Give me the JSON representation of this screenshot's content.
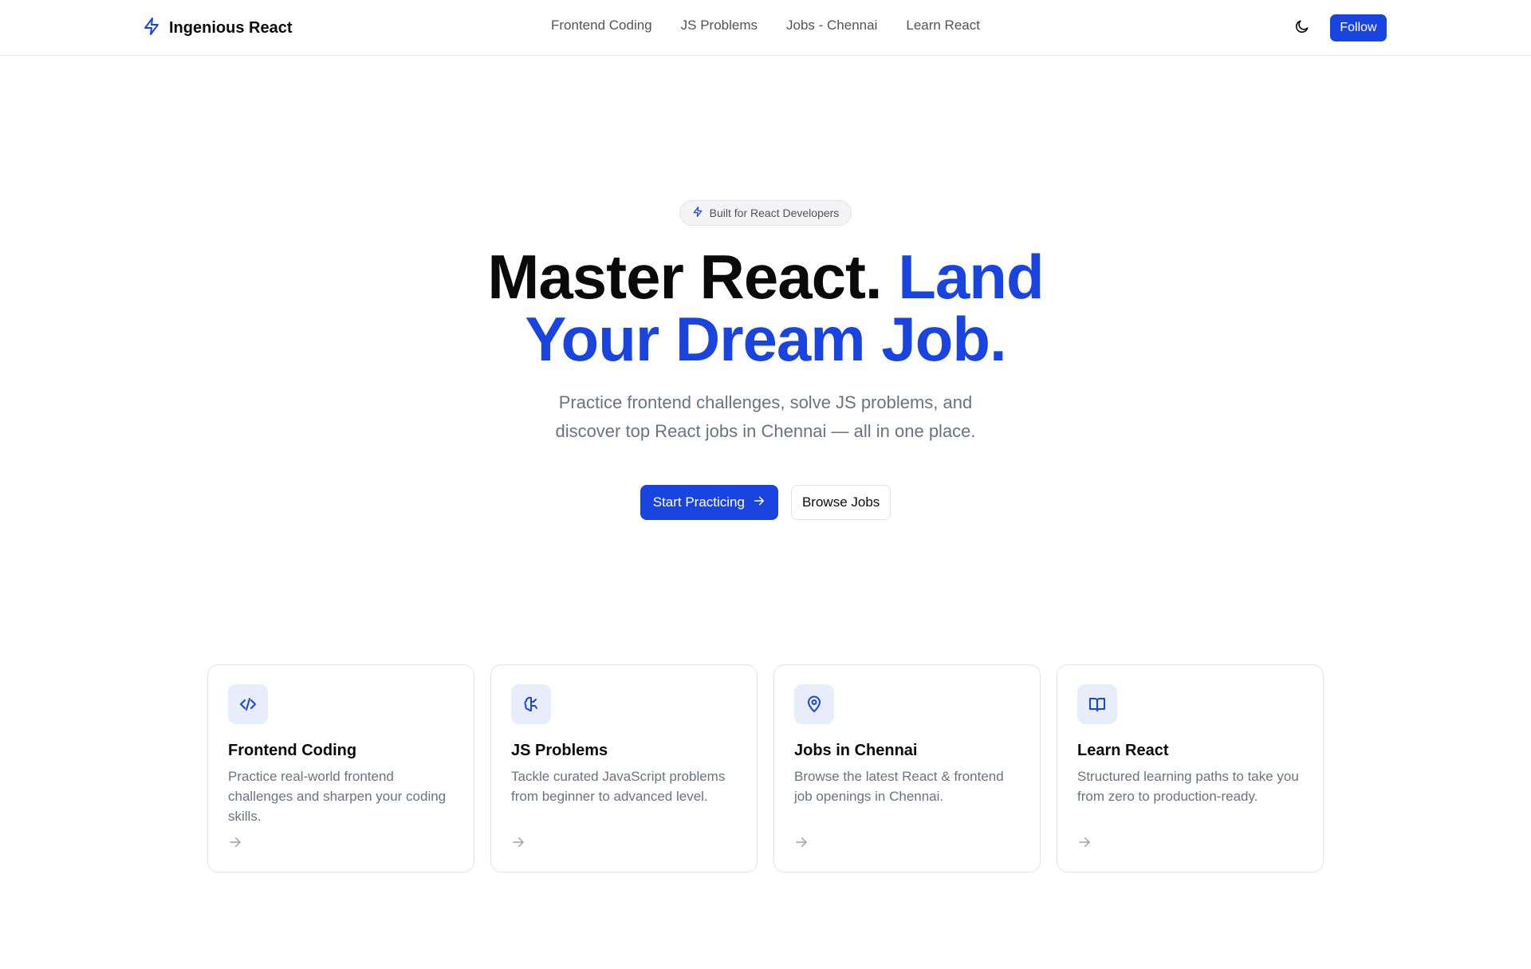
{
  "brand": {
    "name": "Ingenious React",
    "icon": "lightning-icon",
    "accent": "#1a44e0"
  },
  "nav": {
    "links": [
      "Frontend Coding",
      "JS Problems",
      "Jobs - Chennai",
      "Learn React"
    ],
    "theme_icon": "moon-icon",
    "follow_label": "Follow"
  },
  "hero": {
    "badge": "Built for React Developers",
    "title_part1": "Master React.",
    "title_part2": "Land",
    "title_part3": "Your Dream Job.",
    "subtitle_line1": "Practice frontend challenges, solve JS problems, and",
    "subtitle_line2": "discover top React jobs in Chennai — all in one place.",
    "primary_cta": "Start Practicing",
    "secondary_cta": "Browse Jobs"
  },
  "cards": [
    {
      "icon": "code-icon",
      "title": "Frontend Coding",
      "description": "Practice real-world frontend challenges and sharpen your coding skills."
    },
    {
      "icon": "brain-icon",
      "title": "JS Problems",
      "description": "Tackle curated JavaScript problems from beginner to advanced level."
    },
    {
      "icon": "map-pin-icon",
      "title": "Jobs in Chennai",
      "description": "Browse the latest React & frontend job openings in Chennai."
    },
    {
      "icon": "book-icon",
      "title": "Learn React",
      "description": "Structured learning paths to take you from zero to production-ready."
    }
  ],
  "colors": {
    "primary": "#1a44e0",
    "text": "#0a0a0a",
    "muted": "#6b7280",
    "border": "#e4e4e7"
  }
}
